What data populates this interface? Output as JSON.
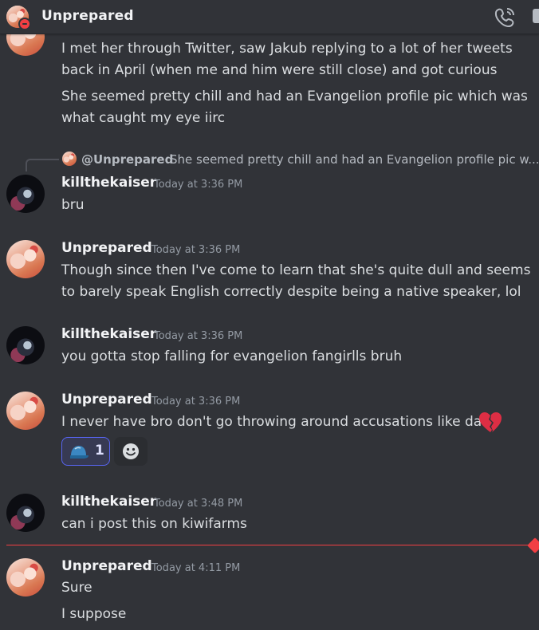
{
  "header": {
    "title": "Unprepared",
    "call_icon": "phone-call-icon",
    "extra_icon": "partial-icon"
  },
  "colors": {
    "background": "#313338",
    "text": "#dbdee1",
    "username": "#f2f3f5",
    "timestamp": "#949ba4",
    "accent": "#5865f2",
    "new_divider": "#f23f43"
  },
  "messages": {
    "m0": {
      "line1": "I met her through Twitter, saw Jakub replying to a lot of her tweets",
      "line2": "back in April (when me and him were still close) and got curious",
      "line3": "She seemed pretty chill and had an Evangelion profile pic which was",
      "line4": "what caught my eye iirc"
    },
    "m1": {
      "reply_name": "@Unprepared",
      "reply_text": "She seemed pretty chill and had an Evangelion profile pic w...",
      "username": "killthekaiser",
      "time": "Today at 3:36 PM",
      "line1": "bru"
    },
    "m2": {
      "username": "Unprepared",
      "time": "Today at 3:36 PM",
      "line1": "Though since then I've come to learn that she's quite dull and seems",
      "line2": "to barely speak English correctly despite being a native speaker, lol"
    },
    "m3": {
      "username": "killthekaiser",
      "time": "Today at 3:36 PM",
      "line1": "you gotta stop falling for evangelion fangirlls bruh"
    },
    "m4": {
      "username": "Unprepared",
      "time": "Today at 3:36 PM",
      "line1": "I never have bro don't go throwing around accusations like dat",
      "emoji": "broken-heart-icon",
      "reaction": {
        "emoji": "blue-cap-icon",
        "count": "1"
      },
      "add_reaction_icon": "smiley-add-reaction-icon"
    },
    "m5": {
      "username": "killthekaiser",
      "time": "Today at 3:48 PM",
      "line1": "can i post this on kiwifarms"
    },
    "m6": {
      "username": "Unprepared",
      "time": "Today at 4:11 PM",
      "line1": "Sure",
      "line2": "I suppose"
    }
  }
}
